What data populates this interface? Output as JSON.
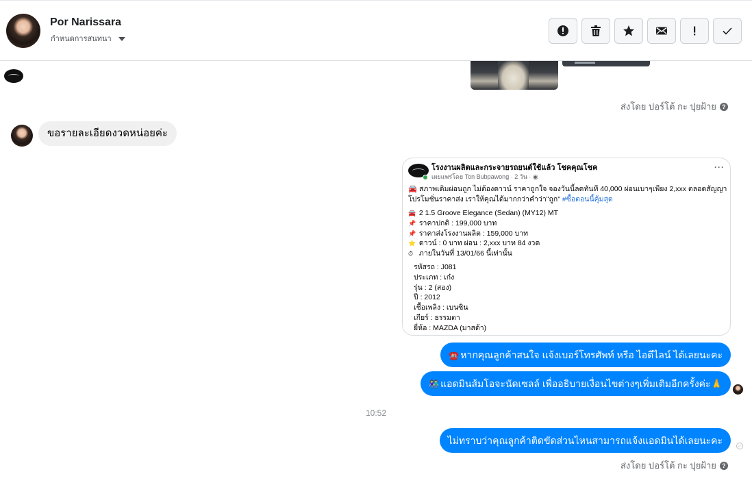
{
  "header": {
    "name": "Por Narissara",
    "subtitle": "กำหนดการสนทนา",
    "actions": [
      {
        "icon": "report-icon",
        "symbol": "!"
      },
      {
        "icon": "trash-icon"
      },
      {
        "icon": "star-icon"
      },
      {
        "icon": "mail-icon"
      },
      {
        "icon": "exclamation-icon",
        "symbol": "!"
      },
      {
        "icon": "check-icon"
      }
    ]
  },
  "conversation": {
    "sent_by_1": "ส่งโดย ปอร์โต้ กะ ปุยฝ้าย",
    "incoming_message": "ขอรายละเอียดงวดหน่อยค่ะ",
    "post": {
      "page_name": "โรงงานผลิตและกระจายรถยนต์ใช้แล้ว โชคคุณโชค",
      "meta": "เผยแพร่โดย Ton Bubpawong · 2 วัน ·",
      "body": "🚘 สภาพเดิมผ่อนถูก ไม่ต้องดาวน์ ราคาถูกใจ จองวันนี้ลดทันที 40,000 ผ่อนเบาๆเพียง 2,xxx ตลอดสัญญา โปรโมชั่นราคาส่ง เราให้คุณได้มากกว่าคำว่า\"ถูก\"",
      "hashtag": "#ซื้อตอนนี้คุ้มสุด",
      "lines": [
        {
          "emoji": "🚘",
          "text": "2 1.5 Groove Elegance (Sedan) (MY12) MT"
        },
        {
          "emoji": "📌",
          "text": "ราคาปกติ : 199,000 บาท"
        },
        {
          "emoji": "📌",
          "text": "ราคาส่งโรงงานผลิต : 159,000 บาท"
        },
        {
          "emoji": "⭐",
          "text": "ดาวน์ : 0 บาท ผ่อน : 2,xxx บาท 84 งวด"
        },
        {
          "emoji": "⏱",
          "text": "ภายในวันที่ 13/01/66 นี้เท่านั้น"
        }
      ],
      "specs": [
        "รหัสรถ : J081",
        "ประเภท : เก๋ง",
        "รุ่น : 2 (สอง)",
        "ปี : 2012",
        "เชื้อเพลิง : เบนซิน",
        "เกียร์ : ธรรมดา",
        "ยี่ห้อ : MAZDA (มาสด้า)"
      ]
    },
    "out_messages": [
      {
        "emoji": "☎️",
        "text": "หากคุณลูกค้าสนใจ แจ้งเบอร์โทรศัพท์ หรือ ไอดีไลน์  ได้เลยนะคะ"
      },
      {
        "emoji": "👫",
        "text": "แอดมินส้มโอจะนัดเซลล์  เพื่ออธิบายเงื่อนไขต่างๆเพิ่มเติมอีกครั้งค่ะ🙏"
      }
    ],
    "timestamp": "10:52",
    "last_message": "ไม่ทราบว่าคุณลูกค้าติดขัดส่วนไหนสามารถแจ้งแอดมินได้เลยนะคะ",
    "sent_by_2": "ส่งโดย ปอร์โต้ กะ ปุยฝ้าย"
  }
}
